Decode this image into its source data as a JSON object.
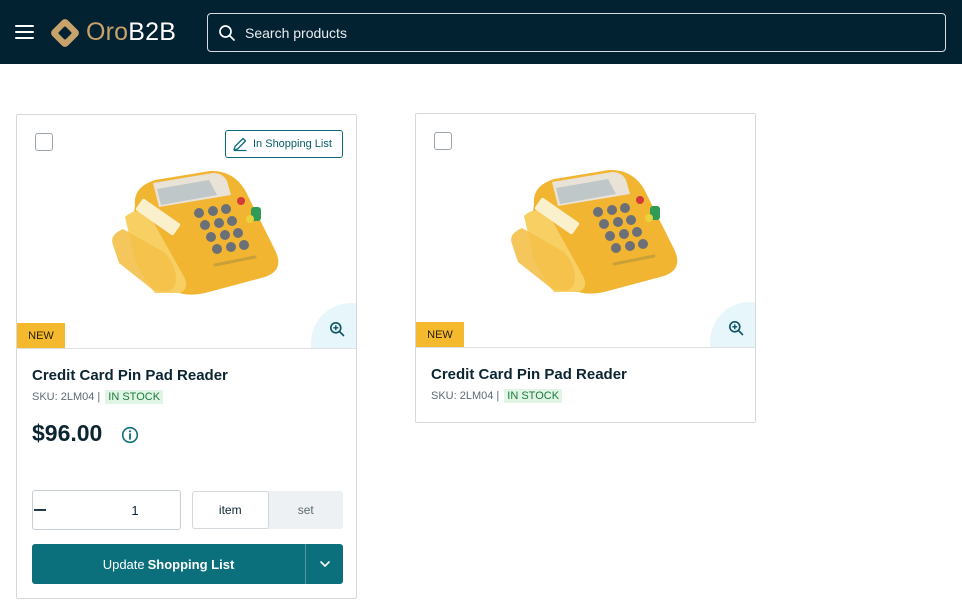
{
  "header": {
    "logo_prefix": "Oro",
    "logo_suffix": "B2B",
    "search_placeholder": "Search products"
  },
  "products": [
    {
      "name": "Credit Card Pin Pad Reader",
      "sku_label": "SKU: 2LM04 |",
      "stock": "IN STOCK",
      "badge": "NEW",
      "in_list_label": "In Shopping List",
      "price": "$96.00",
      "quantity": "1",
      "units": [
        "item",
        "set"
      ],
      "selected_unit": "item",
      "cta_prefix": "Update",
      "cta_bold": "Shopping List"
    },
    {
      "name": "Credit Card Pin Pad Reader",
      "sku_label": "SKU: 2LM04 |",
      "stock": "IN STOCK",
      "badge": "NEW"
    }
  ],
  "colors": {
    "header_bg": "#032231",
    "accent": "#0b6f7c",
    "badge_new": "#f5b92e",
    "in_stock_bg": "#e1f5e6",
    "in_stock_text": "#1d7a3a",
    "logo_gold": "#c8a26b"
  },
  "icons": {
    "menu": "hamburger-icon",
    "search": "search-icon",
    "edit": "pencil-icon",
    "zoom": "zoom-in-icon",
    "info": "info-icon",
    "minus": "minus-icon",
    "plus": "plus-icon",
    "dropdown": "chevron-down-icon"
  }
}
